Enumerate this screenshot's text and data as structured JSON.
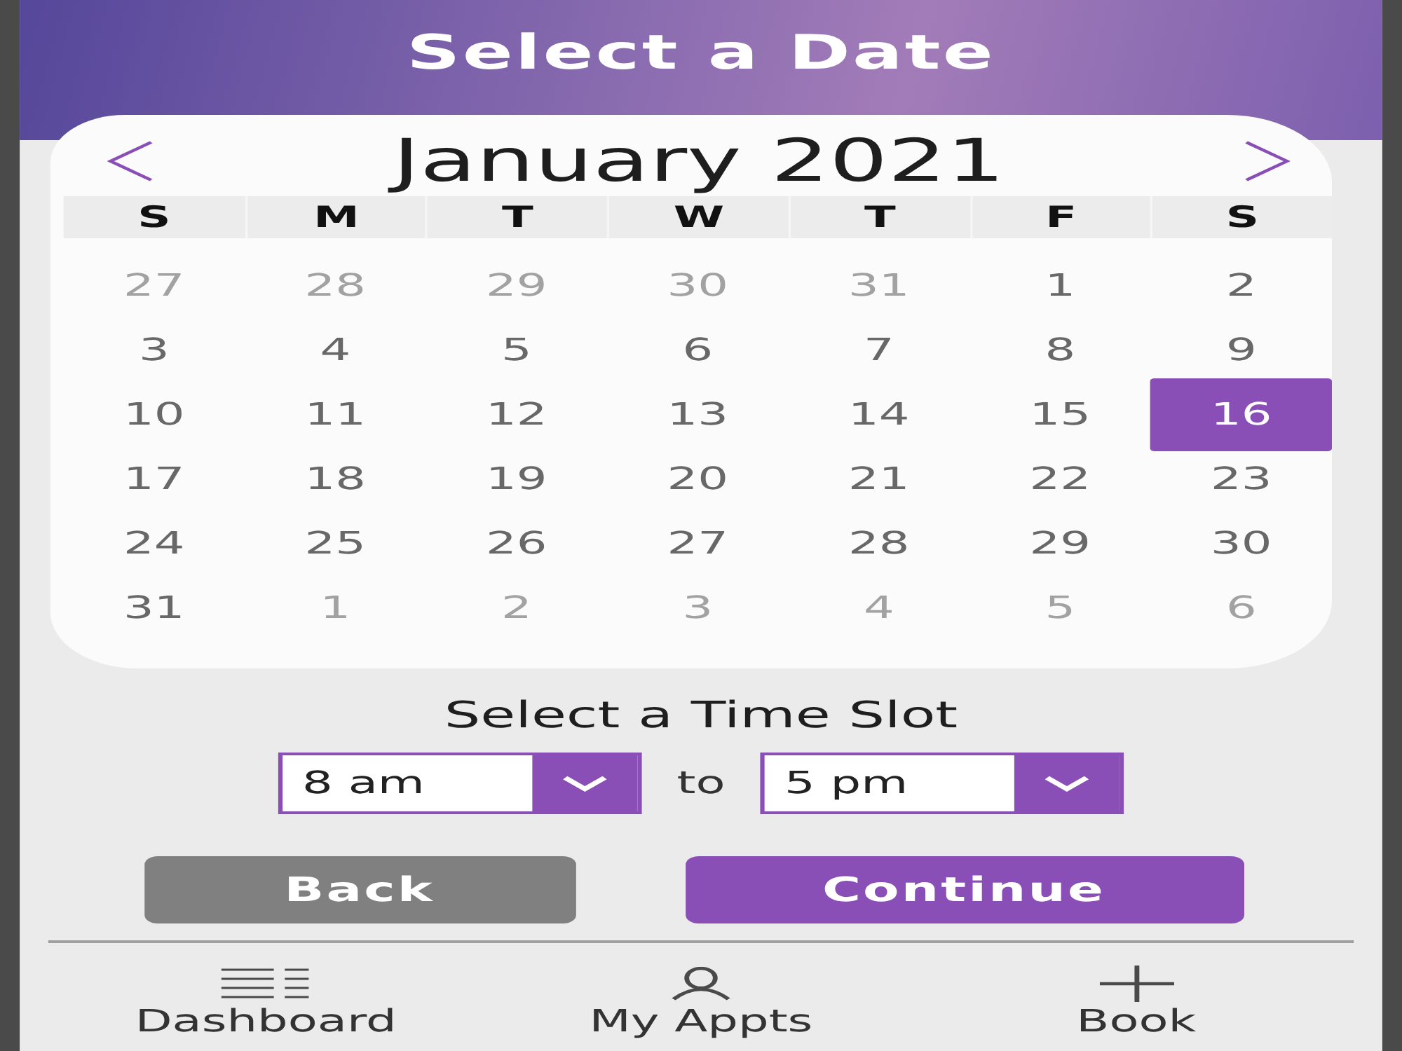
{
  "header": {
    "title": "Select a Date"
  },
  "calendar": {
    "month": "January 2021",
    "weekdays": [
      "S",
      "M",
      "T",
      "W",
      "T",
      "F",
      "S"
    ],
    "days": [
      {
        "label": "27",
        "other_month": true,
        "selected": false
      },
      {
        "label": "28",
        "other_month": true,
        "selected": false
      },
      {
        "label": "29",
        "other_month": true,
        "selected": false
      },
      {
        "label": "30",
        "other_month": true,
        "selected": false
      },
      {
        "label": "31",
        "other_month": true,
        "selected": false
      },
      {
        "label": "1",
        "other_month": false,
        "selected": false
      },
      {
        "label": "2",
        "other_month": false,
        "selected": false
      },
      {
        "label": "3",
        "other_month": false,
        "selected": false
      },
      {
        "label": "4",
        "other_month": false,
        "selected": false
      },
      {
        "label": "5",
        "other_month": false,
        "selected": false
      },
      {
        "label": "6",
        "other_month": false,
        "selected": false
      },
      {
        "label": "7",
        "other_month": false,
        "selected": false
      },
      {
        "label": "8",
        "other_month": false,
        "selected": false
      },
      {
        "label": "9",
        "other_month": false,
        "selected": false
      },
      {
        "label": "10",
        "other_month": false,
        "selected": false
      },
      {
        "label": "11",
        "other_month": false,
        "selected": false
      },
      {
        "label": "12",
        "other_month": false,
        "selected": false
      },
      {
        "label": "13",
        "other_month": false,
        "selected": false
      },
      {
        "label": "14",
        "other_month": false,
        "selected": false
      },
      {
        "label": "15",
        "other_month": false,
        "selected": false
      },
      {
        "label": "16",
        "other_month": false,
        "selected": true
      },
      {
        "label": "17",
        "other_month": false,
        "selected": false
      },
      {
        "label": "18",
        "other_month": false,
        "selected": false
      },
      {
        "label": "19",
        "other_month": false,
        "selected": false
      },
      {
        "label": "20",
        "other_month": false,
        "selected": false
      },
      {
        "label": "21",
        "other_month": false,
        "selected": false
      },
      {
        "label": "22",
        "other_month": false,
        "selected": false
      },
      {
        "label": "23",
        "other_month": false,
        "selected": false
      },
      {
        "label": "24",
        "other_month": false,
        "selected": false
      },
      {
        "label": "25",
        "other_month": false,
        "selected": false
      },
      {
        "label": "26",
        "other_month": false,
        "selected": false
      },
      {
        "label": "27",
        "other_month": false,
        "selected": false
      },
      {
        "label": "28",
        "other_month": false,
        "selected": false
      },
      {
        "label": "29",
        "other_month": false,
        "selected": false
      },
      {
        "label": "30",
        "other_month": false,
        "selected": false
      },
      {
        "label": "31",
        "other_month": false,
        "selected": false
      },
      {
        "label": "1",
        "other_month": true,
        "selected": false
      },
      {
        "label": "2",
        "other_month": true,
        "selected": false
      },
      {
        "label": "3",
        "other_month": true,
        "selected": false
      },
      {
        "label": "4",
        "other_month": true,
        "selected": false
      },
      {
        "label": "5",
        "other_month": true,
        "selected": false
      },
      {
        "label": "6",
        "other_month": true,
        "selected": false
      }
    ]
  },
  "time_slot": {
    "label": "Select a Time Slot",
    "from": {
      "value": "8 am"
    },
    "separator": "to",
    "to": {
      "value": "5 pm"
    }
  },
  "buttons": [
    {
      "label": "Back",
      "kind": "secondary"
    },
    {
      "label": "Continue",
      "kind": "primary"
    }
  ],
  "nav": [
    {
      "label": "Dashboard"
    },
    {
      "label": "My Appts"
    },
    {
      "label": "Book"
    }
  ]
}
